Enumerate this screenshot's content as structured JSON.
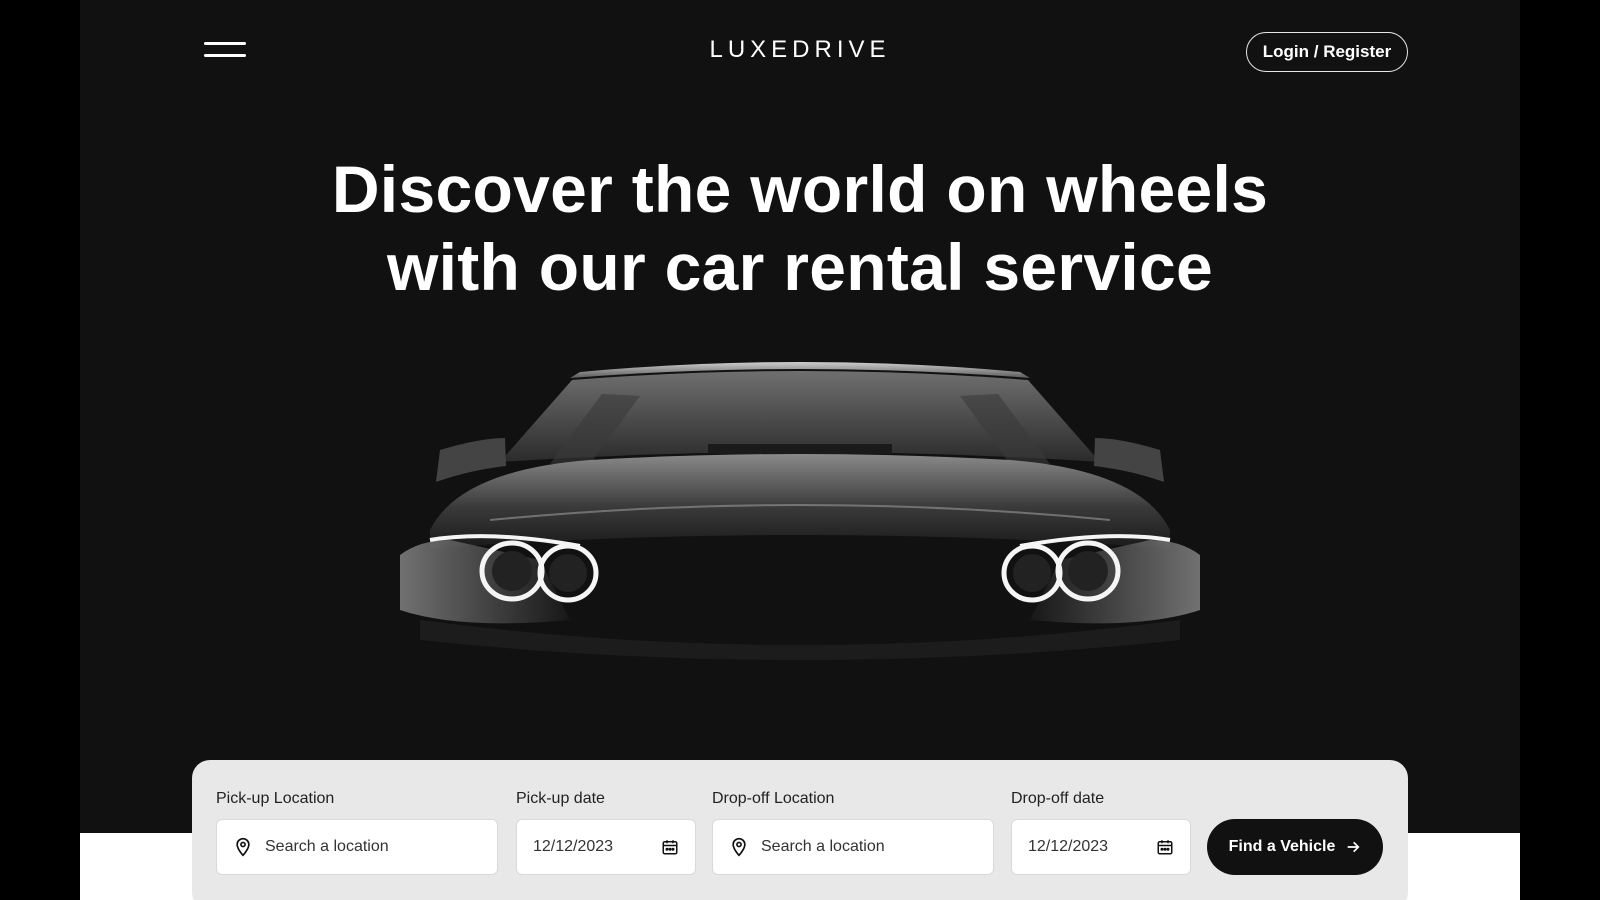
{
  "header": {
    "logo": "LUXEDRIVE",
    "login_label": "Login / Register"
  },
  "hero": {
    "title_line1": "Discover the world on wheels",
    "title_line2": "with our car rental service"
  },
  "booking": {
    "pickup_location": {
      "label": "Pick-up Location",
      "placeholder": "Search a location"
    },
    "pickup_date": {
      "label": "Pick-up date",
      "value": "12/12/2023"
    },
    "dropoff_location": {
      "label": "Drop-off Location",
      "placeholder": "Search a location"
    },
    "dropoff_date": {
      "label": "Drop-off date",
      "value": "12/12/2023"
    },
    "find_label": "Find a Vehicle"
  },
  "icons": {
    "menu": "hamburger-menu-icon",
    "location": "map-pin-icon",
    "calendar": "calendar-icon",
    "arrow": "arrow-right-icon"
  },
  "colors": {
    "hero_bg": "#111111",
    "booking_bg": "#e8e8e8",
    "button_bg": "#111111",
    "text_light": "#ffffff"
  }
}
